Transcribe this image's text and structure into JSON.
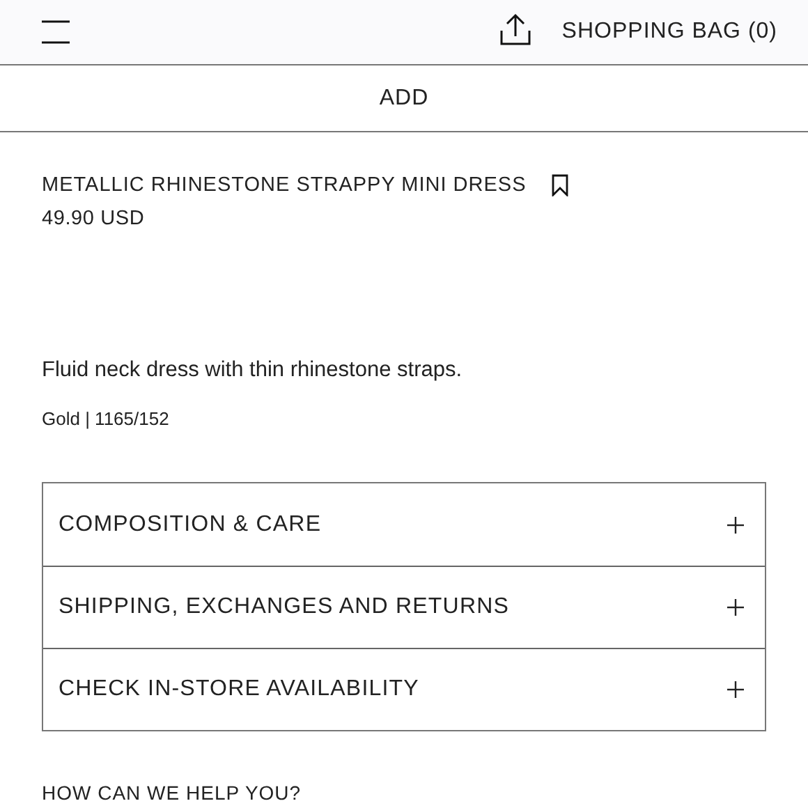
{
  "header": {
    "bag_label": "SHOPPING BAG (0)"
  },
  "add_button": "ADD",
  "product": {
    "name": "METALLIC RHINESTONE STRAPPY MINI DRESS",
    "saved": false,
    "price": "49.90 USD",
    "description": "Fluid neck dress with thin rhinestone straps.",
    "color_ref": "Gold | 1165/152"
  },
  "accordion": [
    {
      "label": "COMPOSITION & CARE",
      "expanded": false
    },
    {
      "label": "SHIPPING, EXCHANGES AND RETURNS",
      "expanded": false
    },
    {
      "label": "CHECK IN-STORE AVAILABILITY",
      "expanded": false
    }
  ],
  "help_heading": "HOW CAN WE HELP YOU?"
}
